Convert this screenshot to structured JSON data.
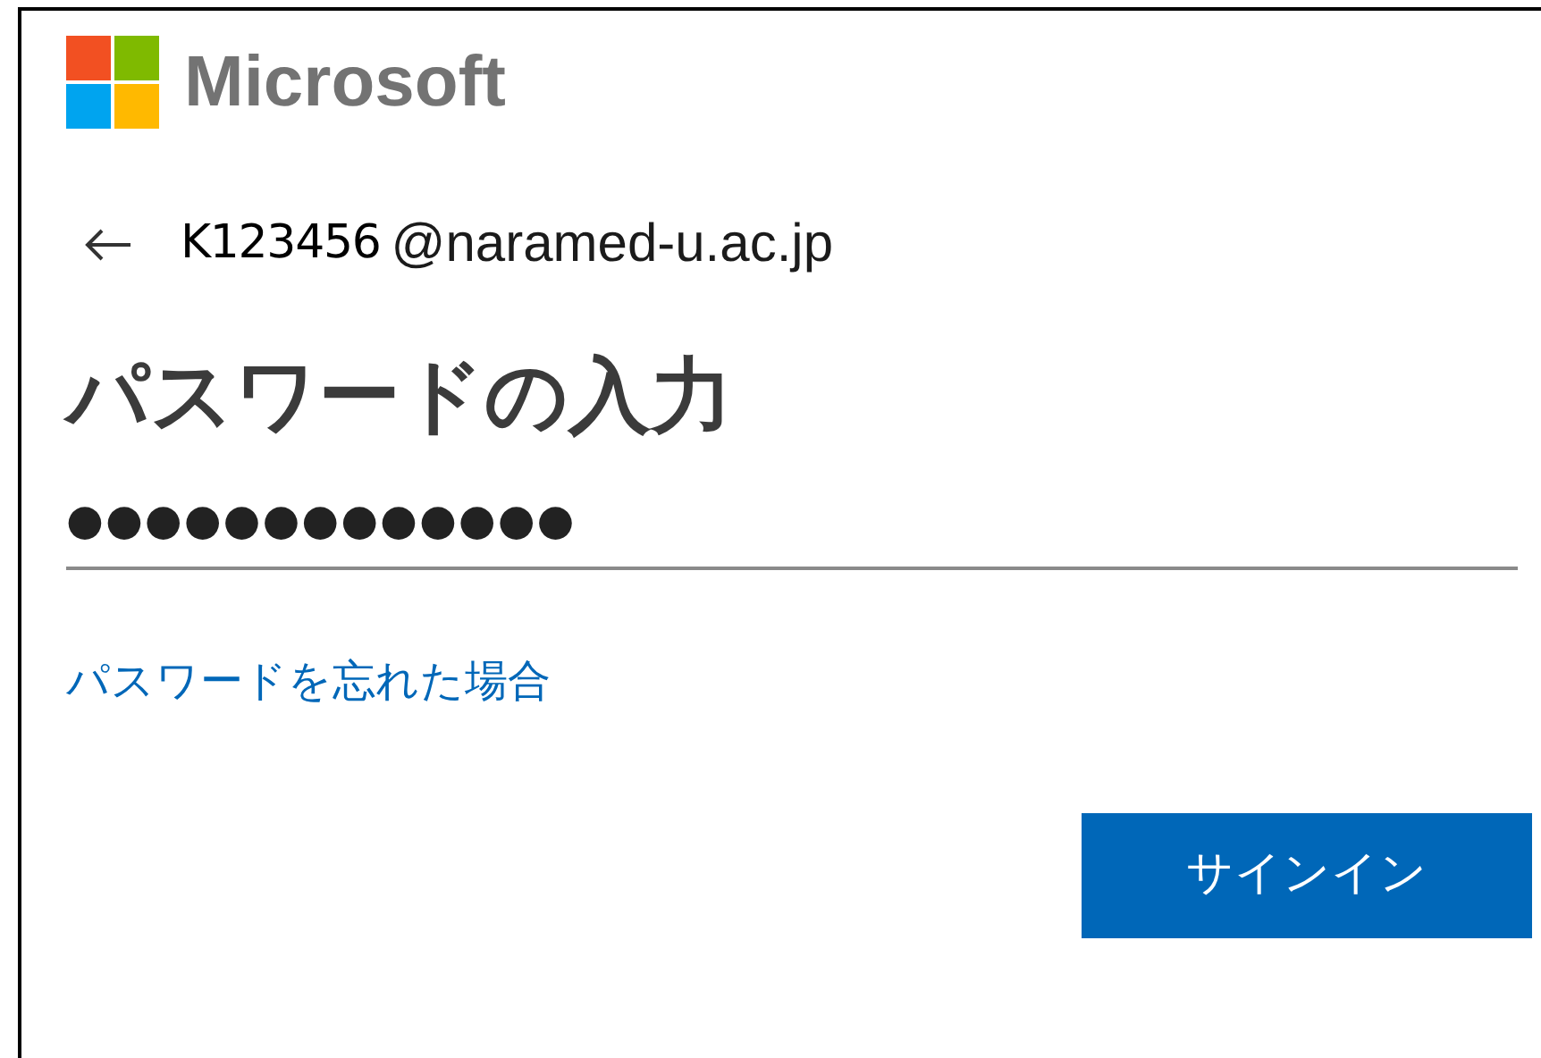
{
  "brand": {
    "name": "Microsoft"
  },
  "account": {
    "user_id": "K123456",
    "domain": "@naramed-u.ac.jp"
  },
  "title": "パスワードの入力",
  "password": {
    "value": "●●●●●●●●●●●●●"
  },
  "forgot_link": "パスワードを忘れた場合",
  "buttons": [
    "サインイン"
  ]
}
